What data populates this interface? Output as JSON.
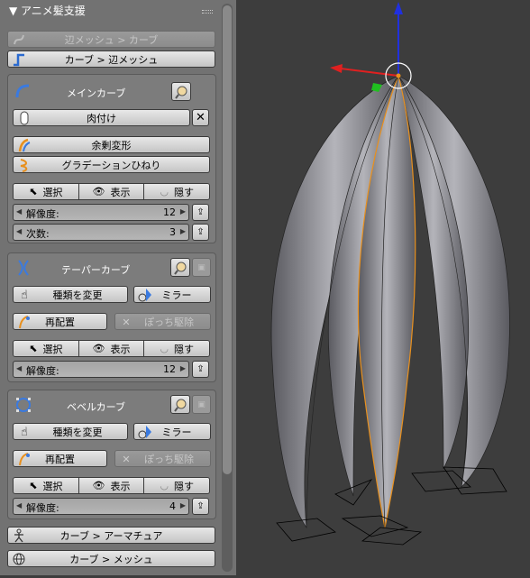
{
  "panel": {
    "title": "▼ アニメ髪支援",
    "edge_to_curve": "辺メッシュ > カーブ",
    "curve_to_edge": "カーブ > 辺メッシュ",
    "main_curve": {
      "title": "メインカーブ",
      "thicken": "肉付け",
      "surplus_deform": "余剰変形",
      "gradation_twist": "グラデーションひねり",
      "select": "選択",
      "show": "表示",
      "hide": "隠す",
      "resolution_label": "解像度:",
      "resolution_value": "12",
      "order_label": "次数:",
      "order_value": "3"
    },
    "taper_curve": {
      "title": "テーパーカーブ",
      "change_type": "種類を変更",
      "mirror": "ミラー",
      "rearrange": "再配置",
      "remove_dots": "ぽっち駆除",
      "select": "選択",
      "show": "表示",
      "hide": "隠す",
      "resolution_label": "解像度:",
      "resolution_value": "12"
    },
    "bevel_curve": {
      "title": "ベベルカーブ",
      "change_type": "種類を変更",
      "mirror": "ミラー",
      "rearrange": "再配置",
      "remove_dots": "ぽっち駆除",
      "select": "選択",
      "show": "表示",
      "hide": "隠す",
      "resolution_label": "解像度:",
      "resolution_value": "4"
    },
    "curve_to_armature": "カーブ > アーマチュア",
    "curve_to_mesh": "カーブ > メッシュ"
  },
  "colors": {
    "panel_bg": "#727272",
    "viewport_bg": "#3d3d3d",
    "axis_x": "#e02020",
    "axis_y": "#20c020",
    "axis_z": "#2030e0",
    "selected_outline": "#e8901e",
    "hair_fill": "#8a8a90"
  }
}
